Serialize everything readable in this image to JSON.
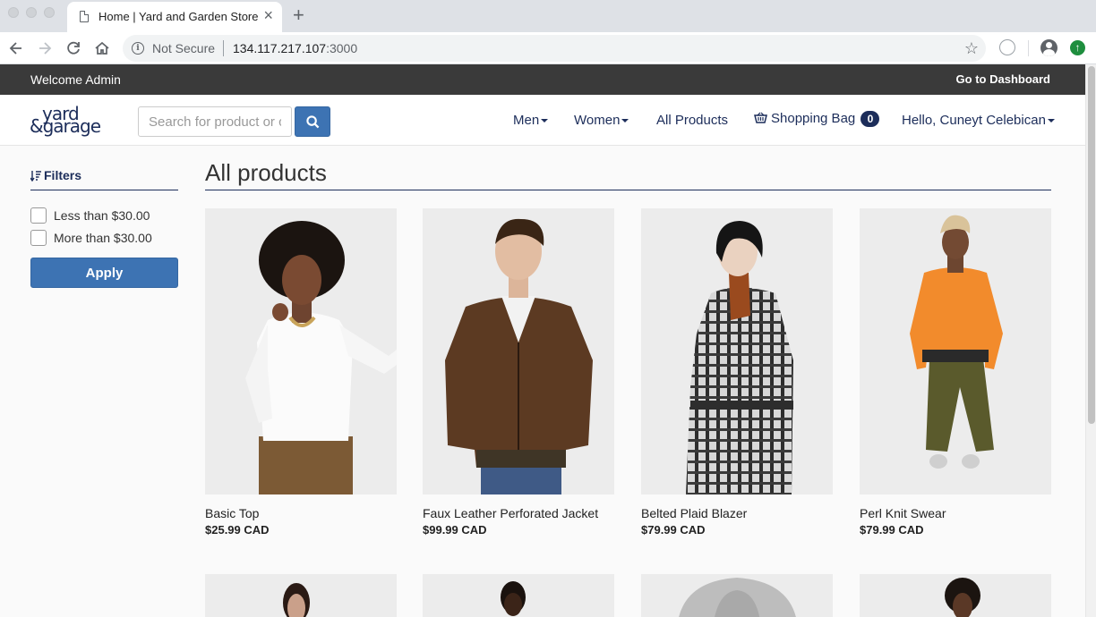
{
  "browser": {
    "tab_title": "Home | Yard and Garden Store",
    "security_label": "Not Secure",
    "url_host": "134.117.217.107",
    "url_port": ":3000"
  },
  "topbar": {
    "welcome": "Welcome Admin",
    "dashboard_link": "Go to Dashboard"
  },
  "header": {
    "logo_line1": "yard",
    "logo_line2": "&garage",
    "search_placeholder": "Search for product or category",
    "nav": {
      "men": "Men",
      "women": "Women",
      "all_products": "All Products",
      "bag": "Shopping Bag",
      "bag_count": "0",
      "user": "Hello, Cuneyt Celebican"
    }
  },
  "filters": {
    "title": "Filters",
    "options": [
      "Less than $30.00",
      "More than $30.00"
    ],
    "apply_label": "Apply"
  },
  "main": {
    "title": "All products",
    "products": [
      {
        "name": "Basic Top",
        "price": "$25.99 CAD"
      },
      {
        "name": "Faux Leather Perforated Jacket",
        "price": "$99.99 CAD"
      },
      {
        "name": "Belted Plaid Blazer",
        "price": "$79.99 CAD"
      },
      {
        "name": "Perl Knit Swear",
        "price": "$79.99 CAD"
      }
    ]
  },
  "colors": {
    "navy": "#1c2d5a",
    "button_blue": "#3d73b3",
    "topbar": "#3a3a3a"
  }
}
